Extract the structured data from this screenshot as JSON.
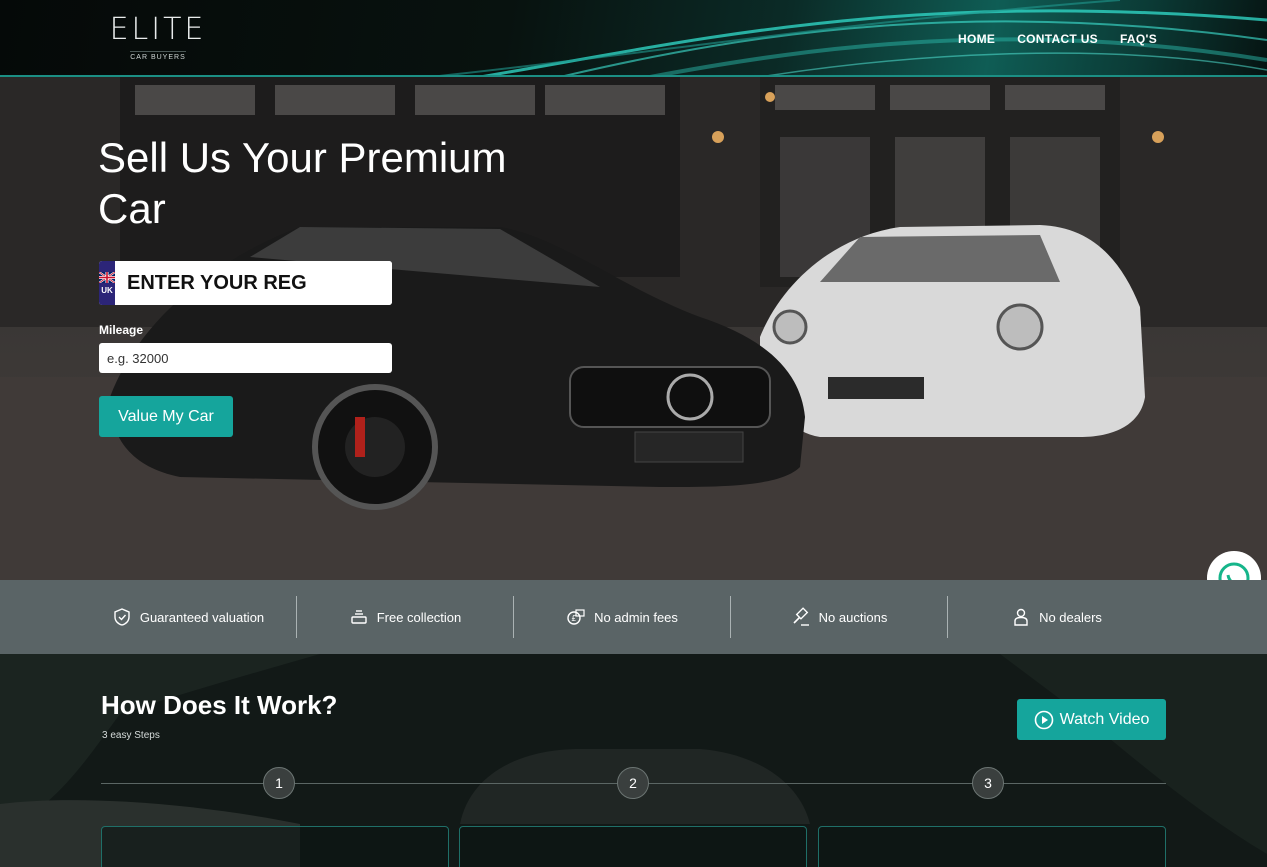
{
  "header": {
    "logo_main": "ELITE",
    "logo_sub": "CAR BUYERS",
    "nav": [
      "HOME",
      "CONTACT US",
      "FAQ'S"
    ]
  },
  "hero": {
    "title": "Sell Us Your Premium Car",
    "reg_country": "UK",
    "reg_placeholder": "ENTER YOUR REG",
    "mileage_label": "Mileage",
    "mileage_placeholder": "e.g. 32000",
    "value_button": "Value My Car"
  },
  "features": [
    {
      "label": "Guaranteed valuation",
      "icon": "shield-check-icon"
    },
    {
      "label": "Free collection",
      "icon": "tray-stack-icon"
    },
    {
      "label": "No admin fees",
      "icon": "pound-cash-icon"
    },
    {
      "label": "No auctions",
      "icon": "gavel-icon"
    },
    {
      "label": "No dealers",
      "icon": "dealer-person-icon"
    }
  ],
  "how": {
    "title": "How Does It Work?",
    "subtitle": "3 easy Steps",
    "watch_button": "Watch Video",
    "steps": [
      "1",
      "2",
      "3"
    ]
  },
  "colors": {
    "accent": "#15a59c",
    "feature_bar": "#5a6466",
    "reg_flag_bg": "#2c2578"
  }
}
